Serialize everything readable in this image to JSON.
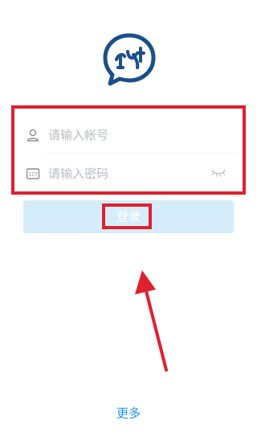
{
  "login": {
    "account_placeholder": "请输入帐号",
    "password_placeholder": "请输入密码",
    "login_label": "登录",
    "more_label": "更多"
  },
  "icons": {
    "logo": "chat-bubble-logo-icon",
    "account": "user-icon",
    "password": "keypad-123-icon",
    "visibility": "eye-closed-icon"
  },
  "colors": {
    "brand_blue": "#1a4f8a",
    "accent_blue": "#1f98e6",
    "placeholder": "#b8bcc2",
    "button_bg": "#d5edfb",
    "annotation_red": "#e0202e"
  }
}
